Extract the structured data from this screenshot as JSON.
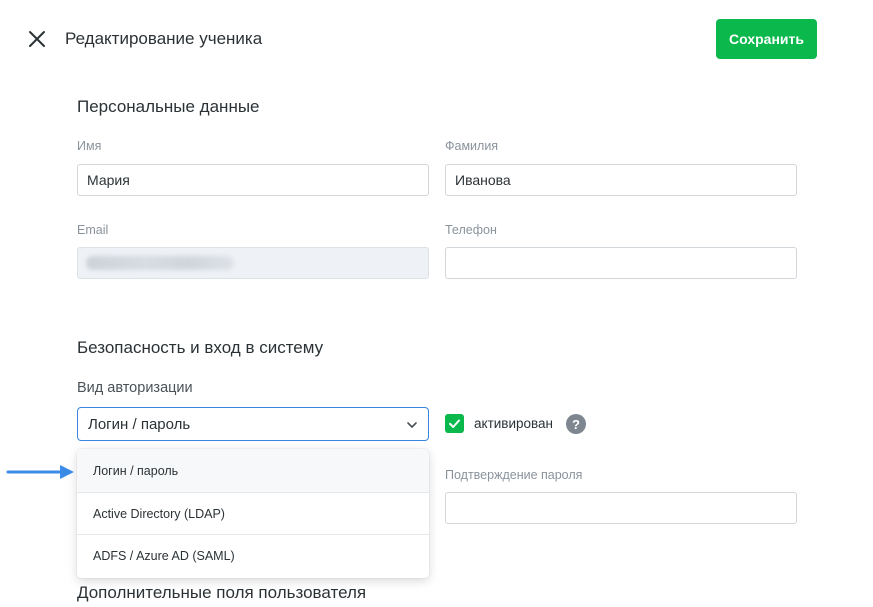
{
  "header": {
    "title": "Редактирование ученика",
    "save_label": "Сохранить"
  },
  "personal": {
    "section_title": "Персональные данные",
    "first_name": {
      "label": "Имя",
      "value": "Мария"
    },
    "last_name": {
      "label": "Фамилия",
      "value": "Иванова"
    },
    "email": {
      "label": "Email",
      "value": ""
    },
    "phone": {
      "label": "Телефон",
      "value": ""
    }
  },
  "security": {
    "section_title": "Безопасность и вход в систему",
    "auth_type_label": "Вид авторизации",
    "auth_type_selected": "Логин / пароль",
    "activated_label": "активирован",
    "activated": true,
    "help_icon_glyph": "?",
    "password_confirm_label": "Подтверждение пароля",
    "password_confirm_value": "",
    "auth_options": [
      "Логин / пароль",
      "Active Directory (LDAP)",
      "ADFS / Azure AD (SAML)"
    ]
  },
  "extra": {
    "section_title": "Дополнительные поля пользователя"
  },
  "colors": {
    "primary_green": "#0bb84b",
    "focus_blue": "#3b86e0",
    "arrow_blue": "#3b8be6"
  },
  "icons": {
    "close": "close-icon",
    "chevron": "chevron-down-icon",
    "check": "checkmark-icon",
    "help": "question-icon",
    "pointer": "arrow-right-icon"
  }
}
